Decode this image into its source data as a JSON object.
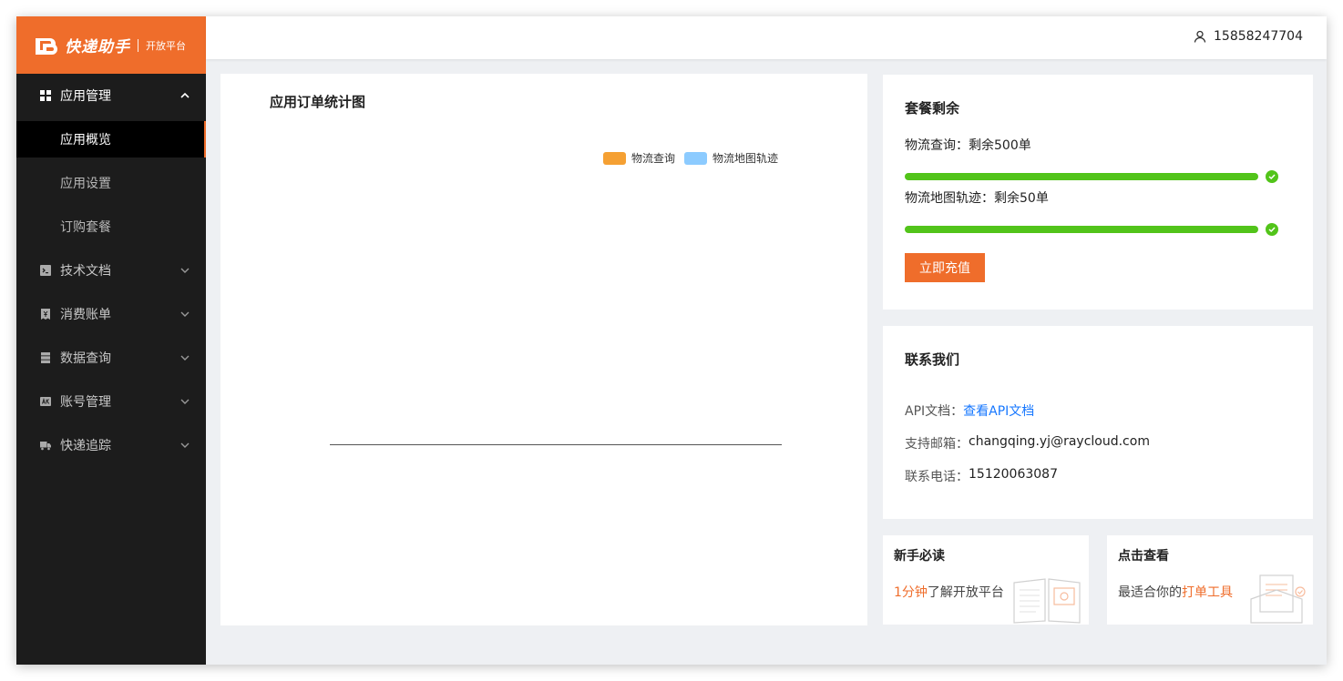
{
  "brand": {
    "name": "快递助手",
    "sub": "开放平台",
    "accent": "#ef6d2b"
  },
  "header": {
    "user": "15858247704",
    "user_icon": "user-icon"
  },
  "sidebar": {
    "groups": [
      {
        "label": "应用管理",
        "icon": "grid-icon",
        "open": true,
        "children": [
          {
            "label": "应用概览",
            "active": true
          },
          {
            "label": "应用设置"
          },
          {
            "label": "订购套餐"
          }
        ]
      },
      {
        "label": "技术文档",
        "icon": "terminal-icon"
      },
      {
        "label": "消费账单",
        "icon": "bill-icon"
      },
      {
        "label": "数据查询",
        "icon": "database-icon"
      },
      {
        "label": "账号管理",
        "icon": "account-icon"
      },
      {
        "label": "快递追踪",
        "icon": "truck-icon"
      }
    ]
  },
  "chart": {
    "title": "应用订单统计图",
    "legend": [
      {
        "name": "物流查询",
        "color": "#f5a033"
      },
      {
        "name": "物流地图轨迹",
        "color": "#8ccbff"
      }
    ]
  },
  "chart_data": {
    "type": "bar",
    "title": "应用订单统计图",
    "categories": [],
    "series": [
      {
        "name": "物流查询",
        "values": []
      },
      {
        "name": "物流地图轨迹",
        "values": []
      }
    ],
    "legend_position": "top-right"
  },
  "quota": {
    "title": "套餐剩余",
    "items": [
      {
        "label": "物流查询：剩余500单",
        "progress": 1.0
      },
      {
        "label": "物流地图轨迹：剩余50单",
        "progress": 1.0
      }
    ],
    "recharge_label": "立即充值",
    "bar_color": "#52c41a"
  },
  "contact": {
    "title": "联系我们",
    "api_label": "API文档：",
    "api_link": "查看API文档",
    "email_label": "支持邮箱：",
    "email": "changqing.yj@raycloud.com",
    "phone_label": "联系电话：",
    "phone": "15120063087"
  },
  "cards": [
    {
      "title": "新手必读",
      "highlight": "1分钟",
      "text": "了解开放平台"
    },
    {
      "title": "点击查看",
      "text": "最适合你的",
      "highlight": "打单工具"
    }
  ]
}
